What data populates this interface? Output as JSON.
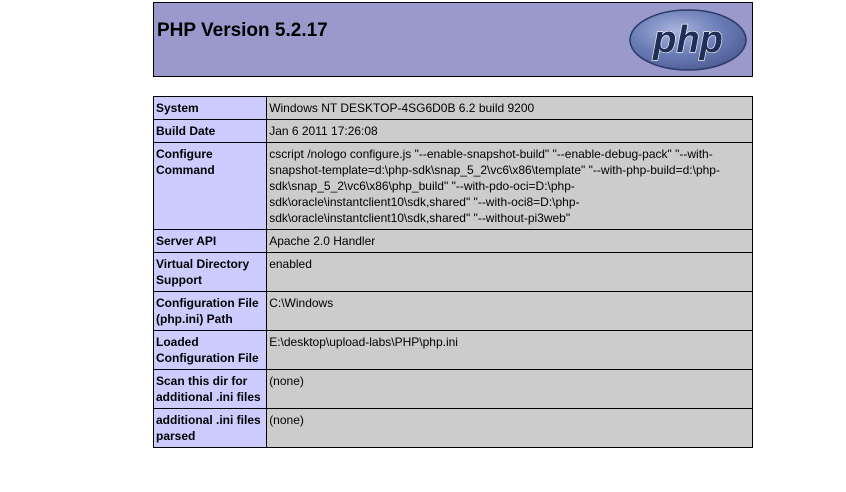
{
  "header": {
    "title": "PHP Version 5.2.17",
    "logo_text": "php",
    "colors": {
      "header_bg": "#9999cc",
      "label_bg": "#ccccff",
      "value_bg": "#cccccc",
      "logo_fill": "#6c7eb7",
      "logo_text": "#1f2f57"
    }
  },
  "rows": [
    {
      "label": "System",
      "value": "Windows NT DESKTOP-4SG6D0B 6.2 build 9200"
    },
    {
      "label": "Build Date",
      "value": "Jan 6 2011 17:26:08"
    },
    {
      "label": "Configure Command",
      "value": "cscript /nologo configure.js \"--enable-snapshot-build\" \"--enable-debug-pack\" \"--with-snapshot-template=d:\\php-sdk\\snap_5_2\\vc6\\x86\\template\" \"--with-php-build=d:\\php-sdk\\snap_5_2\\vc6\\x86\\php_build\" \"--with-pdo-oci=D:\\php-sdk\\oracle\\instantclient10\\sdk,shared\" \"--with-oci8=D:\\php-sdk\\oracle\\instantclient10\\sdk,shared\" \"--without-pi3web\""
    },
    {
      "label": "Server API",
      "value": "Apache 2.0 Handler"
    },
    {
      "label": "Virtual Directory Support",
      "value": "enabled"
    },
    {
      "label": "Configuration File (php.ini) Path",
      "value": "C:\\Windows"
    },
    {
      "label": "Loaded Configuration File",
      "value": "E:\\desktop\\upload-labs\\PHP\\php.ini"
    },
    {
      "label": "Scan this dir for additional .ini files",
      "value": "(none)"
    },
    {
      "label": "additional .ini files parsed",
      "value": "(none)"
    }
  ]
}
